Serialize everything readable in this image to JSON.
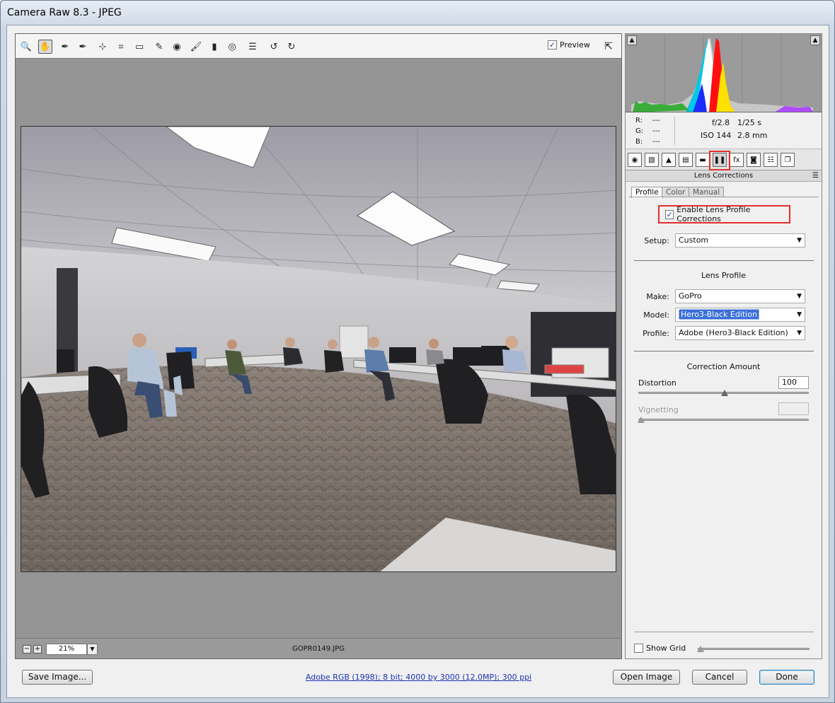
{
  "window": {
    "title": "Camera Raw 8.3  -  JPEG"
  },
  "toolbar": {
    "tools": [
      {
        "name": "zoom-tool",
        "icon": "magnifier-icon",
        "glyph": "🔍"
      },
      {
        "name": "hand-tool",
        "icon": "hand-icon",
        "glyph": "✋"
      },
      {
        "name": "white-balance-tool",
        "icon": "eyedropper-icon",
        "glyph": "✒"
      },
      {
        "name": "color-sampler-tool",
        "icon": "color-sampler-icon",
        "glyph": "✒"
      },
      {
        "name": "targeted-adjustment-tool",
        "icon": "target-icon",
        "glyph": "⊹"
      },
      {
        "name": "crop-tool",
        "icon": "crop-icon",
        "glyph": "⌗"
      },
      {
        "name": "straighten-tool",
        "icon": "level-icon",
        "glyph": "▭"
      },
      {
        "name": "spot-removal-tool",
        "icon": "brush-icon",
        "glyph": "✎"
      },
      {
        "name": "red-eye-tool",
        "icon": "eye-icon",
        "glyph": "◉"
      },
      {
        "name": "adjustment-brush-tool",
        "icon": "paintbrush-icon",
        "glyph": "🖌"
      },
      {
        "name": "graduated-filter-tool",
        "icon": "graduated-filter-icon",
        "glyph": "▮"
      },
      {
        "name": "radial-filter-tool",
        "icon": "radial-filter-icon",
        "glyph": "◎"
      },
      {
        "name": "preferences-tool",
        "icon": "list-icon",
        "glyph": "☰"
      },
      {
        "name": "rotate-ccw-tool",
        "icon": "rotate-left-icon",
        "glyph": "↺"
      },
      {
        "name": "rotate-cw-tool",
        "icon": "rotate-right-icon",
        "glyph": "↻"
      }
    ],
    "preview_label": "Preview",
    "preview_checked": true
  },
  "status": {
    "zoom": "21%",
    "filename": "GOPR0149.JPG"
  },
  "info": {
    "r_label": "R:",
    "g_label": "G:",
    "b_label": "B:",
    "r_value": "---",
    "g_value": "---",
    "b_value": "---",
    "aperture": "f/2.8",
    "shutter": "1/25 s",
    "iso": "ISO 144",
    "focal": "2.8 mm"
  },
  "panel": {
    "title": "Lens Corrections",
    "subtabs": [
      "Profile",
      "Color",
      "Manual"
    ],
    "enable_label": "Enable Lens Profile Corrections",
    "enable_checked": true,
    "setup_label": "Setup:",
    "setup_value": "Custom",
    "lens_profile_title": "Lens Profile",
    "make_label": "Make:",
    "make_value": "GoPro",
    "model_label": "Model:",
    "model_value": "Hero3-Black Edition",
    "profile_label": "Profile:",
    "profile_value": "Adobe (Hero3-Black Edition)",
    "correction_title": "Correction Amount",
    "distortion_label": "Distortion",
    "distortion_value": "100",
    "distortion_fraction": 0.5,
    "vignetting_label": "Vignetting",
    "vignetting_value": "",
    "vignetting_fraction": 0.0,
    "show_grid_label": "Show Grid"
  },
  "footer": {
    "save_label": "Save Image...",
    "workflow_link": "Adobe RGB (1998); 8 bit; 4000 by 3000 (12.0MP); 300 ppi",
    "open_label": "Open Image",
    "cancel_label": "Cancel",
    "done_label": "Done"
  },
  "colors": {
    "highlight_red": "#e0302b",
    "selection_blue": "#3a6fd8",
    "link_blue": "#1a32b8"
  }
}
